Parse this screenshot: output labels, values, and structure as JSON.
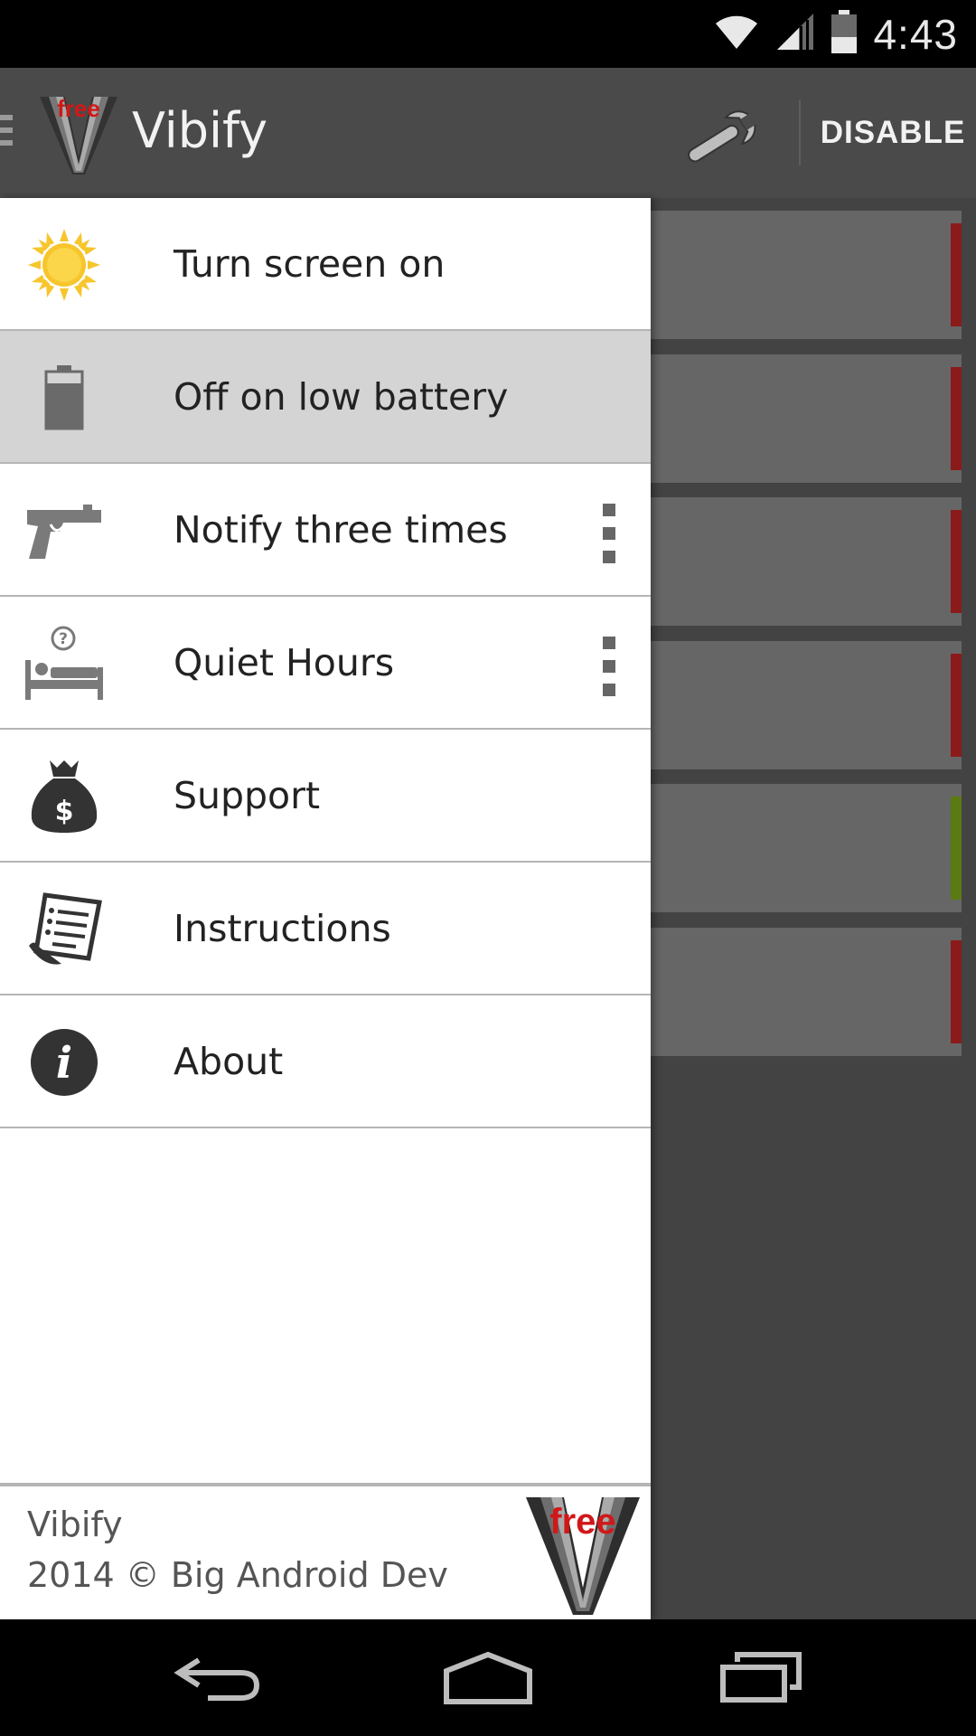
{
  "status_bar": {
    "time": "4:43"
  },
  "action_bar": {
    "title": "Vibify",
    "logo_text": "free",
    "disable_label": "DISABLE",
    "settings_icon": "wrench-icon"
  },
  "drawer": {
    "items": [
      {
        "label": "Turn screen on",
        "icon": "sun-icon",
        "selected": false,
        "has_overflow": false
      },
      {
        "label": "Off on low battery",
        "icon": "battery-icon",
        "selected": true,
        "has_overflow": false
      },
      {
        "label": "Notify three times",
        "icon": "gun-icon",
        "selected": false,
        "has_overflow": true
      },
      {
        "label": "Quiet Hours",
        "icon": "bed-icon",
        "selected": false,
        "has_overflow": true
      },
      {
        "label": "Support",
        "icon": "money-bag-icon",
        "selected": false,
        "has_overflow": false
      },
      {
        "label": "Instructions",
        "icon": "document-icon",
        "selected": false,
        "has_overflow": false
      },
      {
        "label": "About",
        "icon": "info-icon",
        "selected": false,
        "has_overflow": false
      }
    ],
    "footer": {
      "app_name": "Vibify",
      "copyright": "2014 © Big Android Dev"
    }
  },
  "background_cards": {
    "stripe_colors": [
      "#8b1a1a",
      "#8b1a1a",
      "#8b1a1a",
      "#8b1a1a",
      "#5a7a12",
      "#8b1a1a"
    ]
  },
  "colors": {
    "accent_red": "#8b1a1a",
    "accent_green": "#5a7a12",
    "action_bar": "#4a4a4a",
    "selected_item": "#d4d4d4"
  }
}
